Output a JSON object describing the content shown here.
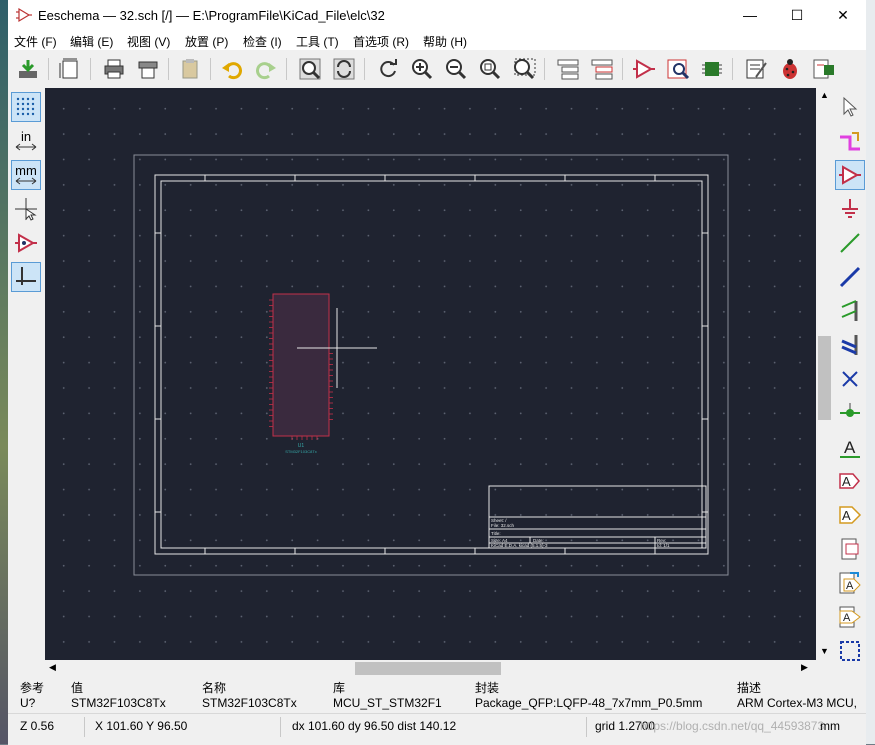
{
  "window": {
    "title": "Eeschema — 32.sch [/] — E:\\ProgramFile\\KiCad_File\\elc\\32",
    "minimize": "—",
    "maximize": "☐",
    "close": "✕"
  },
  "menu": [
    "文件 (F)",
    "编辑 (E)",
    "视图 (V)",
    "放置 (P)",
    "检查 (I)",
    "工具 (T)",
    "首选项 (R)",
    "帮助 (H)"
  ],
  "left_tools": {
    "units_in": "in",
    "units_mm": "mm"
  },
  "right_tools": {
    "text_a": "A",
    "label_a": "A",
    "glabel_a": "A",
    "hlabel_a": "A",
    "sheetpin_a": "A"
  },
  "schematic": {
    "component_ref": "U1",
    "component_value": "STM32F103C8Tx"
  },
  "title_block": {
    "sheet": "Sheet: /",
    "file": "File: 32.sch",
    "title_label": "Title:",
    "size": "Size: A4",
    "date": "Date:",
    "rev": "Rev:",
    "kicad": "KiCad E.D.A. kicad (5.1.5)-3",
    "id": "Id: 1/1"
  },
  "info_panel": {
    "columns": [
      {
        "header": "参考",
        "value": "U?"
      },
      {
        "header": "值",
        "value": "STM32F103C8Tx"
      },
      {
        "header": "名称",
        "value": "STM32F103C8Tx"
      },
      {
        "header": "库",
        "value": "MCU_ST_STM32F1"
      },
      {
        "header": "封装",
        "value": "Package_QFP:LQFP-48_7x7mm_P0.5mm"
      },
      {
        "header": "描述",
        "value": "ARM Cortex-M3 MCU,"
      }
    ]
  },
  "status": {
    "zoom": "Z 0.56",
    "xy": "X 101.60  Y 96.50",
    "dxy": "dx 101.60  dy 96.50  dist 140.12",
    "grid": "grid 1.2700",
    "units": "mm",
    "watermark": "https://blog.csdn.net/qq_44593873"
  },
  "colors": {
    "canvas_bg": "#1f2330",
    "sheet_border": "#e6e6e6",
    "component_body": "#3a2a3e",
    "component_outline": "#c2304a",
    "pin_color": "#c2304a",
    "accent_active": "#5a9bd5"
  }
}
